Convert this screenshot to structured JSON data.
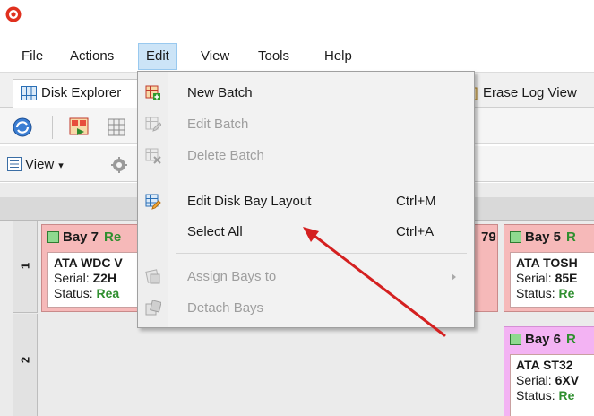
{
  "titlebar": {
    "app_icon": "app-logo-icon"
  },
  "menubar": {
    "items": [
      "File",
      "Actions",
      "Edit",
      "View",
      "Tools",
      "Help"
    ],
    "active": "Edit"
  },
  "tabs": [
    {
      "label": "Disk Explorer",
      "icon": "disk-explorer-icon",
      "active": true
    },
    {
      "label": "Erase Log View",
      "icon": "erase-log-icon",
      "active": false
    }
  ],
  "toolbar": {
    "icons": [
      "refresh-icon",
      "batch-run-icon",
      "batch-grid-icon"
    ]
  },
  "subtoolbar": {
    "view_label": "View",
    "view_icon": "view-list-icon",
    "settings_icon": "gear-icon"
  },
  "edit_menu": {
    "items": [
      {
        "label": "New Batch",
        "icon": "new-batch-icon",
        "enabled": true,
        "shortcut": ""
      },
      {
        "label": "Edit Batch",
        "icon": "edit-batch-icon",
        "enabled": false,
        "shortcut": ""
      },
      {
        "label": "Delete Batch",
        "icon": "delete-batch-icon",
        "enabled": false,
        "shortcut": ""
      },
      {
        "label": "Edit Disk Bay Layout",
        "icon": "edit-disk-bay-layout-icon",
        "enabled": true,
        "shortcut": "Ctrl+M"
      },
      {
        "label": "Select All",
        "icon": "",
        "enabled": true,
        "shortcut": "Ctrl+A"
      },
      {
        "label": "Assign Bays to",
        "icon": "assign-bays-icon",
        "enabled": false,
        "shortcut": "",
        "submenu": true
      },
      {
        "label": "Detach Bays",
        "icon": "detach-bays-icon",
        "enabled": false,
        "shortcut": ""
      }
    ]
  },
  "grid": {
    "rows": [
      "1",
      "2"
    ],
    "hidden_bay_fragment": "79",
    "bays": [
      {
        "name": "Bay 7",
        "state": "Re",
        "model": "ATA WDC V",
        "serial_label": "Serial:",
        "serial": "Z2H",
        "status_label": "Status:",
        "status": "Rea",
        "color": "#f6b9b9"
      },
      {
        "name": "Bay 5",
        "state": "R",
        "model": "ATA TOSH",
        "serial_label": "Serial:",
        "serial": "85E",
        "status_label": "Status:",
        "status": "Re",
        "color": "#f6b9b9"
      },
      {
        "name": "Bay 6",
        "state": "R",
        "model": "ATA ST32",
        "serial_label": "Serial:",
        "serial": "6XV",
        "status_label": "Status:",
        "status": "Re",
        "color": "#f3b3f3"
      }
    ]
  },
  "colors": {
    "menu_highlight": "#cce4f7",
    "annotation_arrow": "#d42020",
    "ready_text": "#2f8f2f"
  }
}
